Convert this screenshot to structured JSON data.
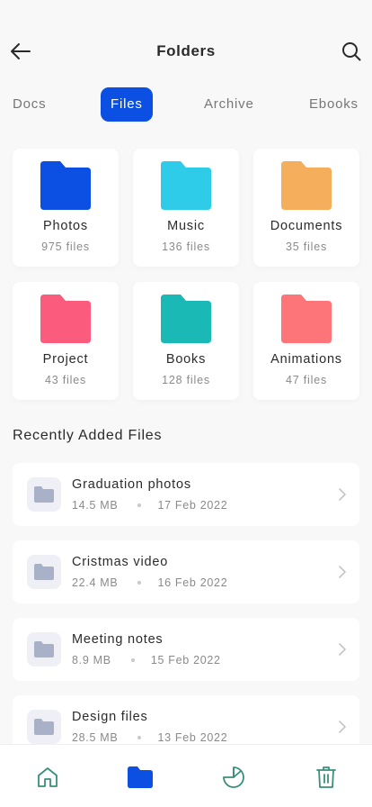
{
  "header": {
    "title": "Folders",
    "back_icon": "arrow-left-icon",
    "search_icon": "search-icon"
  },
  "tabs": [
    {
      "label": "Docs",
      "active": false
    },
    {
      "label": "Files",
      "active": true
    },
    {
      "label": "Archive",
      "active": false
    },
    {
      "label": "Ebooks",
      "active": false
    }
  ],
  "folders": [
    {
      "name": "Photos",
      "count": "975 files",
      "color": "#0b4fe3"
    },
    {
      "name": "Music",
      "count": "136 files",
      "color": "#2fcce9"
    },
    {
      "name": "Documents",
      "count": "35 files",
      "color": "#f5ae5c"
    },
    {
      "name": "Project",
      "count": "43 files",
      "color": "#fb5b7c"
    },
    {
      "name": "Books",
      "count": "128 files",
      "color": "#1ab9b5"
    },
    {
      "name": "Animations",
      "count": "47 files",
      "color": "#fd7479"
    }
  ],
  "recent": {
    "title": "Recently Added Files",
    "items": [
      {
        "name": "Graduation photos",
        "size": "14.5 MB",
        "date": "17 Feb 2022"
      },
      {
        "name": "Cristmas video",
        "size": "22.4 MB",
        "date": "16 Feb 2022"
      },
      {
        "name": "Meeting notes",
        "size": "8.9 MB",
        "date": "15 Feb 2022"
      },
      {
        "name": "Design files",
        "size": "28.5 MB",
        "date": "13 Feb 2022"
      }
    ]
  },
  "nav": {
    "items": [
      "home-icon",
      "folder-icon",
      "pie-chart-icon",
      "trash-icon"
    ],
    "active_index": 1,
    "active_color": "#0b4fe3",
    "inactive_color": "#3a8f7a"
  },
  "colors": {
    "accent": "#0b4fe3",
    "thumb_folder": "#a9b1c9"
  }
}
